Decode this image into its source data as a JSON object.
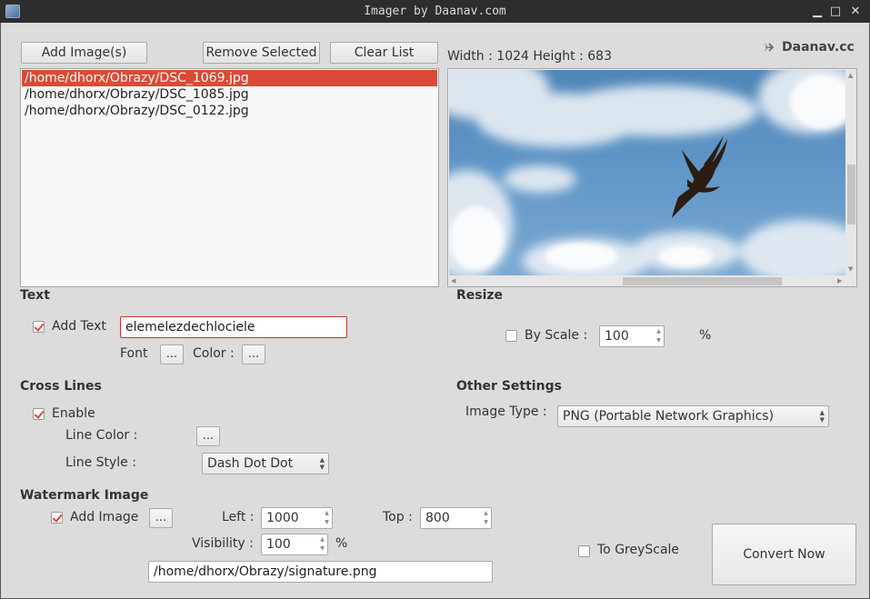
{
  "window": {
    "title": "Imager by Daanav.com",
    "minimize": "▁",
    "maximize": "□",
    "close": "✕"
  },
  "toolbar": {
    "add_images": "Add Image(s)",
    "remove_selected": "Remove Selected",
    "clear_list": "Clear List"
  },
  "files": {
    "items": [
      "/home/dhorx/Obrazy/DSC_1069.jpg",
      "/home/dhorx/Obrazy/DSC_1085.jpg",
      "/home/dhorx/Obrazy/DSC_0122.jpg"
    ],
    "selected_index": 0
  },
  "preview": {
    "dimensions": "Width : 1024 Height : 683",
    "brand": "Daanav.cc",
    "brand_icon": "arrow-right-icon"
  },
  "text_section": {
    "title": "Text",
    "add_text_label": "Add Text",
    "add_text_checked": true,
    "text_value": "elemelezdechlociele",
    "font_label": "Font",
    "color_label": "Color :",
    "ellipsis": "..."
  },
  "resize_section": {
    "title": "Resize",
    "by_scale_label": "By Scale :",
    "by_scale_checked": false,
    "scale_value": "100",
    "unit": "%"
  },
  "cross_lines": {
    "title": "Cross Lines",
    "enable_label": "Enable",
    "enable_checked": true,
    "line_color_label": "Line Color :",
    "line_style_label": "Line Style :",
    "line_style_value": "Dash Dot Dot",
    "ellipsis": "..."
  },
  "other_settings": {
    "title": "Other Settings",
    "image_type_label": "Image Type :",
    "image_type_value": "PNG (Portable Network Graphics)"
  },
  "watermark": {
    "title": "Watermark Image",
    "add_image_label": "Add Image",
    "add_image_checked": true,
    "ellipsis": "...",
    "left_label": "Left :",
    "left_value": "1000",
    "top_label": "Top :",
    "top_value": "800",
    "visibility_label": "Visibility :",
    "visibility_value": "100",
    "unit": "%",
    "path": "/home/dhorx/Obrazy/signature.png"
  },
  "greyscale": {
    "label": "To GreyScale",
    "checked": false
  },
  "convert_label": "Convert Now",
  "colors": {
    "accent": "#db4a36",
    "titlebar": "#2d2d2d",
    "background": "#dcdcdc"
  }
}
